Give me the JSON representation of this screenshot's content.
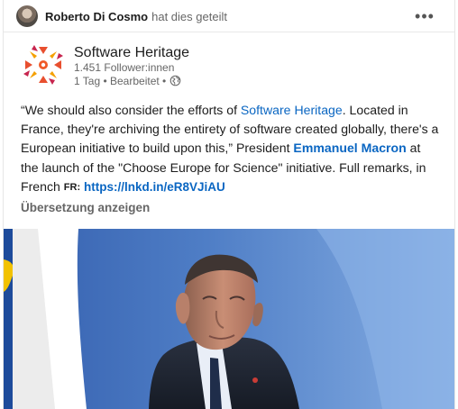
{
  "share": {
    "author": "Roberto Di Cosmo",
    "action": "hat dies geteilt",
    "more_label": "•••"
  },
  "organization": {
    "name": "Software Heritage",
    "followers": "1.451 Follower:innen",
    "time": "1 Tag • Bearbeitet •"
  },
  "post": {
    "text_1": "“We should also consider the efforts of ",
    "mention_1": "Software Heritage",
    "text_2": ". Located in France, they're archiving the entirety of software created globally, there's a European initiative to build upon this,” President ",
    "mention_2": "Emmanuel Macron",
    "text_3": " at the launch of the \"Choose Europe for Science\" initiative. Full remarks, in French ",
    "flag_label": "FR:",
    "link": "https://lnkd.in/eR8VJiAU"
  },
  "translation_button": "Übersetzung anzeigen",
  "colors": {
    "link": "#0a66c2",
    "text": "#1c1c1c",
    "muted": "#666666",
    "media_blue": "#3f6fb8"
  },
  "icons": {
    "more": "more-icon",
    "globe": "globe-icon",
    "logo": "software-heritage-logo-icon"
  }
}
